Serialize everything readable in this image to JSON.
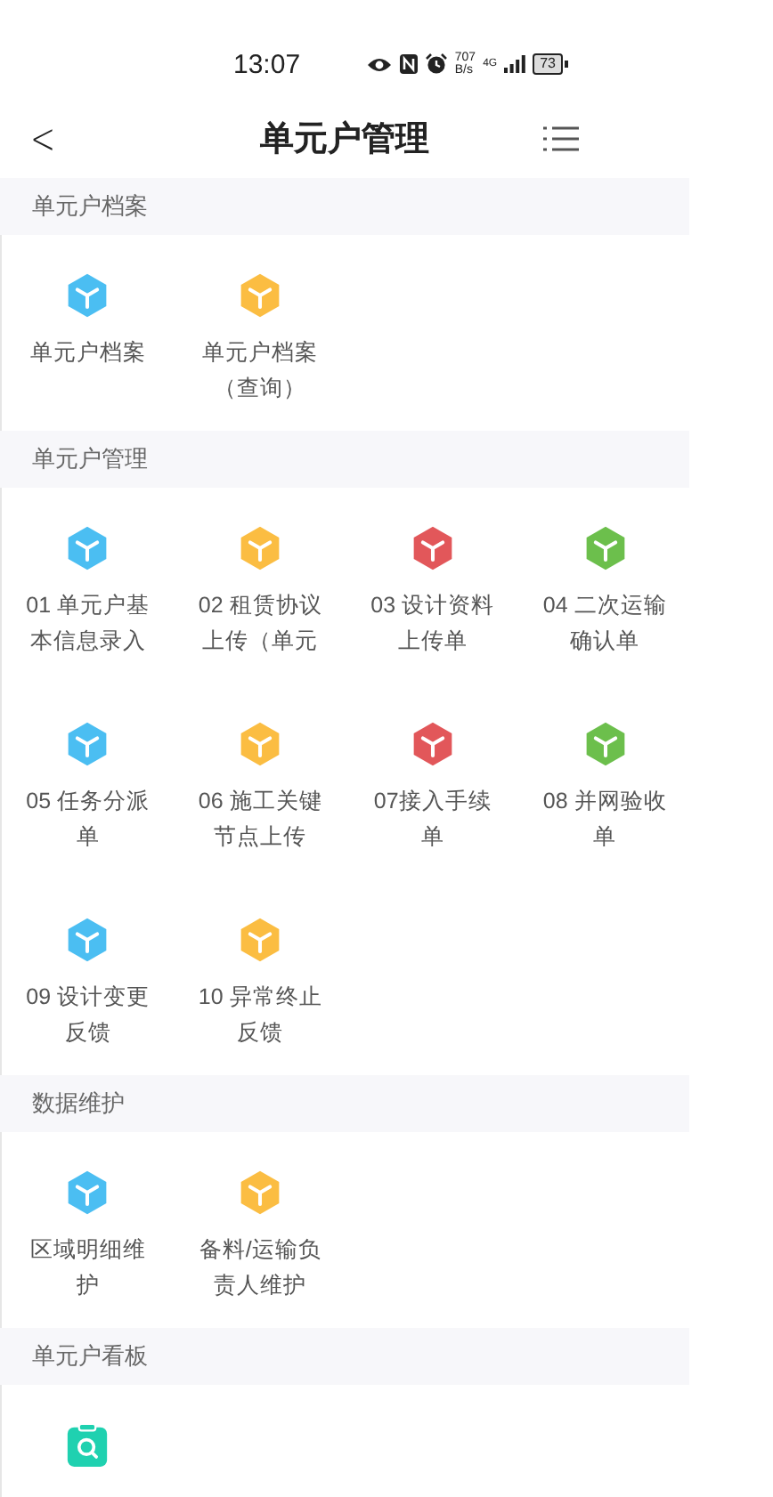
{
  "status_bar": {
    "time": "13:07",
    "net_speed": "707",
    "net_unit": "B/s",
    "network": "4G",
    "battery": "73"
  },
  "header": {
    "back": "<",
    "title": "单元户管理"
  },
  "sections": [
    {
      "title": "单元户档案",
      "items": [
        {
          "kind": "cube",
          "label": "单元户档案",
          "color": "#4bbef2"
        },
        {
          "kind": "cube",
          "label": "单元户档案（查询）",
          "color": "#fbbd42"
        }
      ]
    },
    {
      "title": "单元户管理",
      "items": [
        {
          "kind": "cube",
          "label": "01 单元户基本信息录入",
          "color": "#4bbef2"
        },
        {
          "kind": "cube",
          "label": "02 租赁协议上传（单元",
          "color": "#fbbd42"
        },
        {
          "kind": "cube",
          "label": "03 设计资料上传单",
          "color": "#e2575a"
        },
        {
          "kind": "cube",
          "label": "04 二次运输确认单",
          "color": "#6cbf4c"
        },
        {
          "kind": "cube",
          "label": "05 任务分派单",
          "color": "#4bbef2"
        },
        {
          "kind": "cube",
          "label": "06 施工关键节点上传",
          "color": "#fbbd42"
        },
        {
          "kind": "cube",
          "label": "07接入手续单",
          "color": "#e2575a"
        },
        {
          "kind": "cube",
          "label": "08 并网验收单",
          "color": "#6cbf4c"
        },
        {
          "kind": "cube",
          "label": "09 设计变更反馈",
          "color": "#4bbef2"
        },
        {
          "kind": "cube",
          "label": "10 异常终止反馈",
          "color": "#fbbd42"
        }
      ]
    },
    {
      "title": "数据维护",
      "items": [
        {
          "kind": "cube",
          "label": "区域明细维护",
          "color": "#4bbef2"
        },
        {
          "kind": "cube",
          "label": "备料/运输负责人维护",
          "color": "#fbbd42"
        }
      ]
    },
    {
      "title": "单元户看板",
      "items": [
        {
          "kind": "clipboard",
          "color": "#1fd1b0"
        }
      ]
    }
  ]
}
